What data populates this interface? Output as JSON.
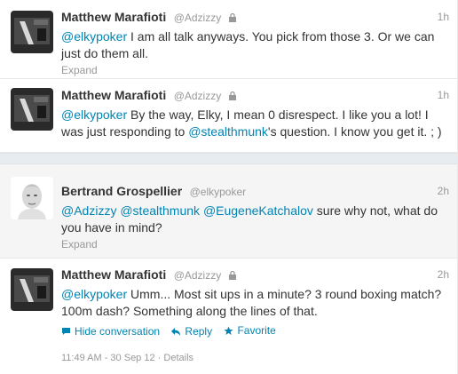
{
  "tweets": [
    {
      "fullname": "Matthew Marafioti",
      "username": "@Adzizzy",
      "time": "1h",
      "parts": [
        {
          "text": "@elkypoker",
          "mention": true
        },
        {
          "text": " I am all talk anyways. You pick from those 3. Or we can just do them all.",
          "mention": false
        }
      ],
      "expand": "Expand"
    },
    {
      "fullname": "Matthew Marafioti",
      "username": "@Adzizzy",
      "time": "1h",
      "parts": [
        {
          "text": "@elkypoker",
          "mention": true
        },
        {
          "text": " By the way, Elky, I mean 0 disrespect. I like you a lot! I was just responding to ",
          "mention": false
        },
        {
          "text": "@stealthmunk",
          "mention": true
        },
        {
          "text": "'s question. I know you get it. ; )",
          "mention": false
        }
      ],
      "expand": ""
    },
    {
      "fullname": "Bertrand Grospellier",
      "username": "@elkypoker",
      "time": "2h",
      "parts": [
        {
          "text": "@Adzizzy",
          "mention": true
        },
        {
          "text": " ",
          "mention": false
        },
        {
          "text": "@stealthmunk",
          "mention": true
        },
        {
          "text": " ",
          "mention": false
        },
        {
          "text": "@EugeneKatchalov",
          "mention": true
        },
        {
          "text": " sure why not, what do you have in mind?",
          "mention": false
        }
      ],
      "expand": "Expand"
    },
    {
      "fullname": "Matthew Marafioti",
      "username": "@Adzizzy",
      "time": "2h",
      "parts": [
        {
          "text": "@elkypoker",
          "mention": true
        },
        {
          "text": " Umm... Most sit ups in a minute? 3 round boxing match? 100m dash? Something along the lines of that.",
          "mention": false
        }
      ],
      "expand": ""
    }
  ],
  "actions": {
    "hide_conversation": "Hide conversation",
    "reply": "Reply",
    "favorite": "Favorite"
  },
  "meta": {
    "timestamp": "11:49 AM - 30 Sep 12",
    "separator": "·",
    "details": "Details"
  },
  "colors": {
    "mention": "#0084b4",
    "muted": "#999999",
    "text": "#333333"
  }
}
